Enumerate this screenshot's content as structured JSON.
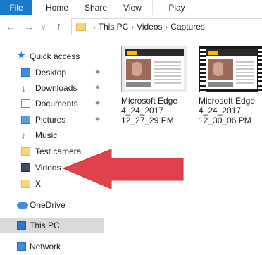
{
  "ribbon": {
    "tabs": [
      "File",
      "Home",
      "Share",
      "View",
      "Play"
    ]
  },
  "address": {
    "crumbs": [
      "This PC",
      "Videos",
      "Captures"
    ]
  },
  "nav": {
    "quick_access": "Quick access",
    "items": [
      {
        "label": "Desktop",
        "icon": "desktop-icon",
        "pinned": true
      },
      {
        "label": "Downloads",
        "icon": "download-icon",
        "pinned": true
      },
      {
        "label": "Documents",
        "icon": "documents-icon",
        "pinned": true
      },
      {
        "label": "Pictures",
        "icon": "pictures-icon",
        "pinned": true
      },
      {
        "label": "Music",
        "icon": "music-icon",
        "pinned": false
      },
      {
        "label": "Test camera",
        "icon": "folder-icon",
        "pinned": false
      },
      {
        "label": "Videos",
        "icon": "videos-icon",
        "pinned": false
      },
      {
        "label": "X",
        "icon": "folder-icon",
        "pinned": false
      }
    ],
    "onedrive": "OneDrive",
    "this_pc": "This PC",
    "network": "Network"
  },
  "files": [
    {
      "line1": "Microsoft Edge",
      "line2": "4_24_2017",
      "line3": "12_27_29 PM"
    },
    {
      "line1": "Microsoft Edge",
      "line2": "4_24_2017",
      "line3": "12_30_06 PM"
    }
  ],
  "colors": {
    "file_tab": "#1979ca",
    "selected": "#d9d9d9",
    "arrow": "#e0414b",
    "accent": "#1e7fd8"
  }
}
